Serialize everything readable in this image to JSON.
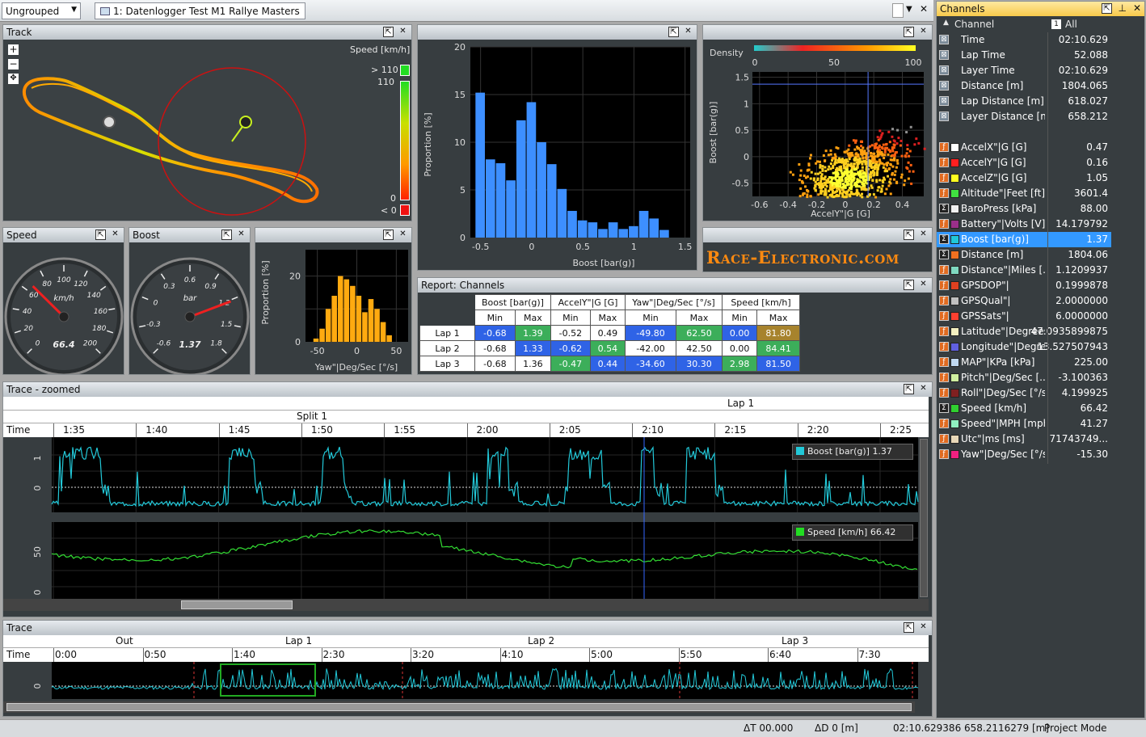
{
  "toolbar": {
    "group_select": "Ungrouped",
    "document_tab": "1: Datenlogger Test M1 Rallye Masters"
  },
  "track": {
    "title": "Track",
    "legend_title": "Speed [km/h]",
    "labels": [
      "> 110",
      "110",
      "0",
      "< 0"
    ],
    "zoom_in": "+",
    "zoom_out": "−"
  },
  "hist1": {
    "type": "bar",
    "xlabel": "Boost [bar(g)]",
    "ylabel": "Proportion [%]",
    "xticks": [
      "-0.5",
      "0",
      "0.5",
      "1",
      "1.5"
    ],
    "yticks": [
      "0",
      "5",
      "10",
      "15",
      "20"
    ],
    "bins_from": -0.55,
    "bin_width": 0.1,
    "values": [
      15.2,
      8.2,
      7.8,
      6.0,
      12.3,
      14.2,
      10.0,
      7.7,
      5.1,
      2.8,
      1.8,
      1.6,
      0.9,
      1.6,
      0.9,
      1.2,
      2.8,
      2.0,
      0.8
    ]
  },
  "scatter": {
    "density_label": "Density",
    "density_ticks": [
      "0",
      "50",
      "100"
    ],
    "xlabel": "AccelY\"|G [G]",
    "ylabel": "Boost [bar(g)]",
    "xticks": [
      "-0.6",
      "-0.4",
      "-0.2",
      "0",
      "0.2",
      "0.4"
    ],
    "yticks": [
      "-0.5",
      "0",
      "0.5",
      "1",
      "1.5"
    ]
  },
  "speed_gauge": {
    "title": "Speed",
    "unit": "km/h",
    "ticks": [
      "0",
      "20",
      "40",
      "60",
      "80",
      "100",
      "120",
      "140",
      "160",
      "180",
      "200"
    ],
    "value": "66.4",
    "value_num": 66.4,
    "max": 200
  },
  "boost_gauge": {
    "title": "Boost",
    "unit": "bar",
    "ticks": [
      "-0.6",
      "-0.3",
      "0",
      "0.3",
      "0.6",
      "0.9",
      "1.2",
      "1.5",
      "1.8"
    ],
    "value": "1.37",
    "value_num": 1.37,
    "min": -0.9,
    "max": 2.1
  },
  "hist2": {
    "xlabel": "Yaw\"|Deg/Sec [°/s]",
    "ylabel": "Proportion [%]",
    "xticks": [
      "-50",
      "0",
      "50"
    ],
    "yticks": [
      "0",
      "20"
    ],
    "values": [
      1,
      4,
      10,
      14,
      20,
      19,
      17,
      14,
      9,
      13,
      10,
      6,
      2
    ]
  },
  "logo": "Race-Electronic.com",
  "report": {
    "title": "Report: Channels",
    "groups": [
      "Boost [bar(g)]",
      "AccelY\"|G [G]",
      "Yaw\"|Deg/Sec [°/s]",
      "Speed [km/h]"
    ],
    "subheads": [
      "Min",
      "Max",
      "Min",
      "Max",
      "Min",
      "Max",
      "Min",
      "Max"
    ],
    "rows": [
      {
        "label": "Lap 1",
        "cells": [
          "-0.68",
          "1.39",
          "-0.52",
          "0.49",
          "-49.80",
          "62.50",
          "0.00",
          "81.80"
        ]
      },
      {
        "label": "Lap 2",
        "cells": [
          "-0.68",
          "1.33",
          "-0.62",
          "0.54",
          "-42.00",
          "42.50",
          "0.00",
          "84.41"
        ]
      },
      {
        "label": "Lap 3",
        "cells": [
          "-0.68",
          "1.36",
          "-0.47",
          "0.44",
          "-34.60",
          "30.30",
          "2.98",
          "81.50"
        ]
      }
    ],
    "colors": [
      [
        "#2f63e6",
        "#3cae5a",
        "#ffffff",
        "#ffffff",
        "#2f63e6",
        "#3cae5a",
        "#2f63e6",
        "#a7832d"
      ],
      [
        "#ffffff",
        "#2f63e6",
        "#2f63e6",
        "#3cae5a",
        "#ffffff",
        "#ffffff",
        "#ffffff",
        "#3cae5a"
      ],
      [
        "#ffffff",
        "#ffffff",
        "#3cae5a",
        "#2f63e6",
        "#2f63e6",
        "#2f63e6",
        "#3cae5a",
        "#2f63e6"
      ]
    ]
  },
  "trace_zoom": {
    "title": "Trace - zoomed",
    "lap_label": "Lap 1",
    "split_label": "Split 1",
    "time_label": "Time",
    "times": [
      "1:35",
      "1:40",
      "1:45",
      "1:50",
      "1:55",
      "2:00",
      "2:05",
      "2:10",
      "2:15",
      "2:20",
      "2:25"
    ],
    "boost_legend": "Boost [bar(g)]  1.37",
    "speed_legend": "Speed [km/h]  66.42",
    "boost_y": [
      "1",
      "0"
    ],
    "speed_y": [
      "50",
      "0"
    ]
  },
  "trace": {
    "title": "Trace",
    "laps": [
      "Out",
      "Lap 1",
      "Lap 2",
      "Lap 3"
    ],
    "time_label": "Time",
    "times": [
      "0:00",
      "0:50",
      "1:40",
      "2:30",
      "3:20",
      "4:10",
      "5:00",
      "5:50",
      "6:40",
      "7:30"
    ],
    "y": [
      "0"
    ]
  },
  "channels": {
    "title": "Channels",
    "col_channel": "Channel",
    "col_all": "All",
    "group1": [
      {
        "name": "Time",
        "value": "02:10.629"
      },
      {
        "name": "Lap Time",
        "value": "52.088"
      },
      {
        "name": "Layer Time",
        "value": "02:10.629"
      },
      {
        "name": "Distance [m]",
        "value": "1804.065"
      },
      {
        "name": "Lap Distance [m]",
        "value": "618.027"
      },
      {
        "name": "Layer Distance [m]",
        "value": "658.212"
      }
    ],
    "group2": [
      {
        "name": "AccelX\"|G [G]",
        "value": "0.47",
        "color": "#ffffff",
        "icon": "f"
      },
      {
        "name": "AccelY\"|G [G]",
        "value": "0.16",
        "color": "#ff2020",
        "icon": "f"
      },
      {
        "name": "AccelZ\"|G [G]",
        "value": "1.05",
        "color": "#ffff20",
        "icon": "f"
      },
      {
        "name": "Altitude\"|Feet [ft]",
        "value": "3601.4",
        "color": "#40e040",
        "icon": "f"
      },
      {
        "name": "BaroPress [kPa]",
        "value": "88.00",
        "color": "#f0f0f0",
        "icon": "s"
      },
      {
        "name": "Battery\"|Volts [V]",
        "value": "14.179792",
        "color": "#9a2f8a",
        "icon": "f"
      },
      {
        "name": "Boost [bar(g)]",
        "value": "1.37",
        "color": "#20c8d8",
        "icon": "s",
        "selected": true
      },
      {
        "name": "Distance [m]",
        "value": "1804.06",
        "color": "#f07020",
        "icon": "s"
      },
      {
        "name": "Distance\"|Miles [...",
        "value": "1.1209937",
        "color": "#7fd8c0",
        "icon": "f"
      },
      {
        "name": "GPSDOP\"|",
        "value": "0.1999878",
        "color": "#e04020",
        "icon": "f"
      },
      {
        "name": "GPSQual\"|",
        "value": "2.0000000",
        "color": "#c0c0c0",
        "icon": "f"
      },
      {
        "name": "GPSSats\"|",
        "value": "6.0000000",
        "color": "#ff4030",
        "icon": "f"
      },
      {
        "name": "Latitude\"|Degrees...",
        "value": "47.0935899875",
        "color": "#f4f0c0",
        "icon": "f"
      },
      {
        "name": "Longitude\"|Degre...",
        "value": "13.527507943",
        "color": "#6060e0",
        "icon": "f"
      },
      {
        "name": "MAP\"|KPa [kPa]",
        "value": "225.00",
        "color": "#c0d8f0",
        "icon": "f"
      },
      {
        "name": "Pitch\"|Deg/Sec [...",
        "value": "-3.100363",
        "color": "#d0f0a0",
        "icon": "f"
      },
      {
        "name": "Roll\"|Deg/Sec [°/s]",
        "value": "4.199925",
        "color": "#802020",
        "icon": "f"
      },
      {
        "name": "Speed [km/h]",
        "value": "66.42",
        "color": "#30d030",
        "icon": "s"
      },
      {
        "name": "Speed\"|MPH [mph]",
        "value": "41.27",
        "color": "#90f0c0",
        "icon": "f"
      },
      {
        "name": "Utc\"|ms [ms]",
        "value": "71743749...",
        "color": "#e8d8b8",
        "icon": "f"
      },
      {
        "name": "Yaw\"|Deg/Sec [°/s]",
        "value": "-15.30",
        "color": "#f02080",
        "icon": "f"
      }
    ]
  },
  "status": {
    "dt": "ΔT 00.000",
    "dd": "ΔD 0 [m]",
    "time": "02:10.629386",
    "dist": "658.2116279 [m]",
    "mode": "Project Mode"
  }
}
